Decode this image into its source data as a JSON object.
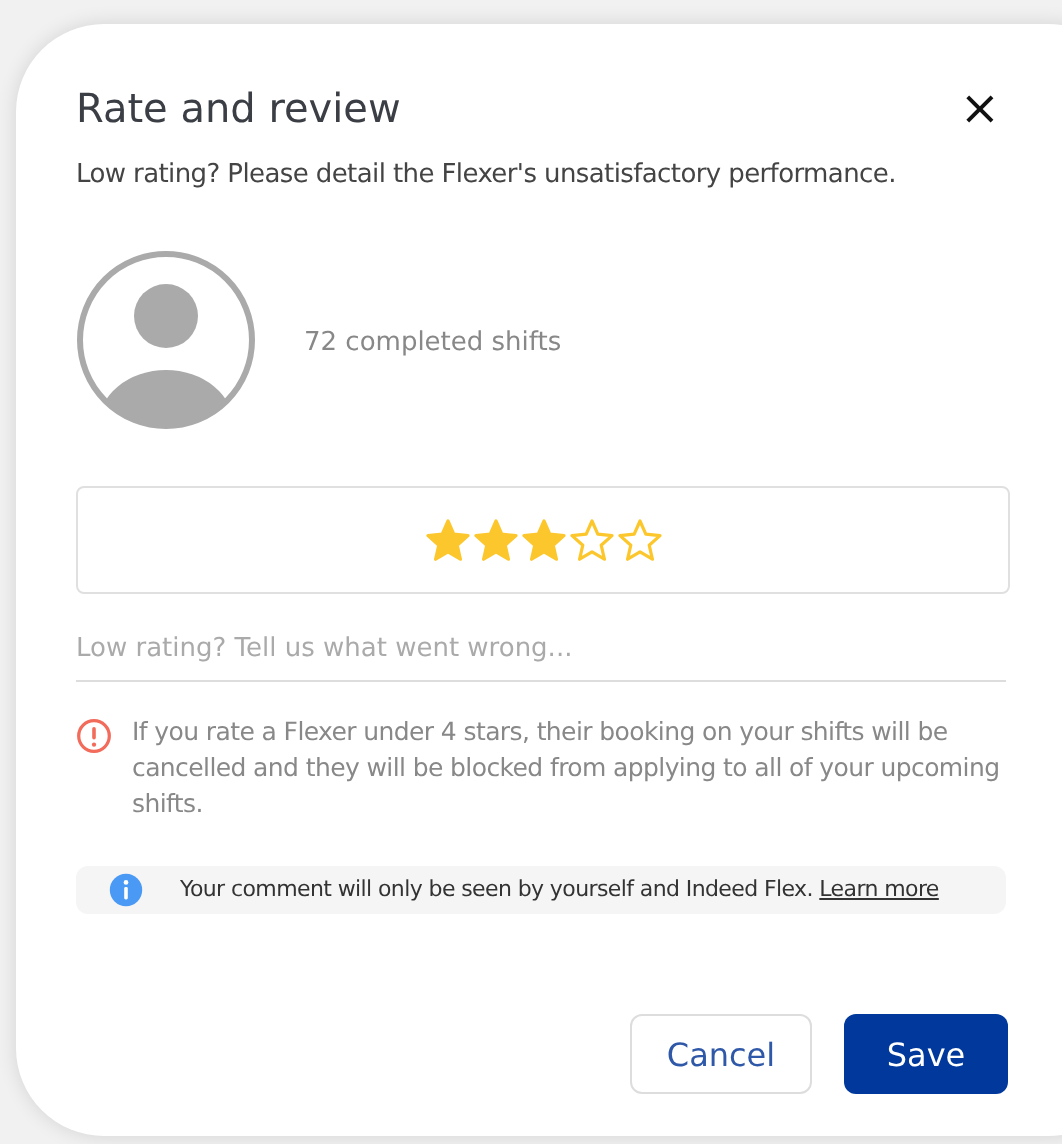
{
  "dialog": {
    "title": "Rate and review",
    "close": "×",
    "subtitle": "Low rating? Please detail the Flexer's unsatisfactory performance."
  },
  "flexer": {
    "completed_shifts": "72 completed shifts"
  },
  "rating": {
    "stars": 3
  },
  "comment": {
    "placeholder": "Low rating? Tell us what went wrong..."
  },
  "warning": "If you rate a Flexer under 4 stars, their booking on your shifts will be cancelled and they will be blocked from applying to all of your upcoming shifts.",
  "info": {
    "text": "Your comment will only be seen by yourself and Indeed Flex.",
    "link": "Learn more"
  },
  "buttons": [
    {
      "label": "Cancel",
      "kind": "secondary"
    },
    {
      "label": "Save",
      "kind": "primary"
    }
  ]
}
